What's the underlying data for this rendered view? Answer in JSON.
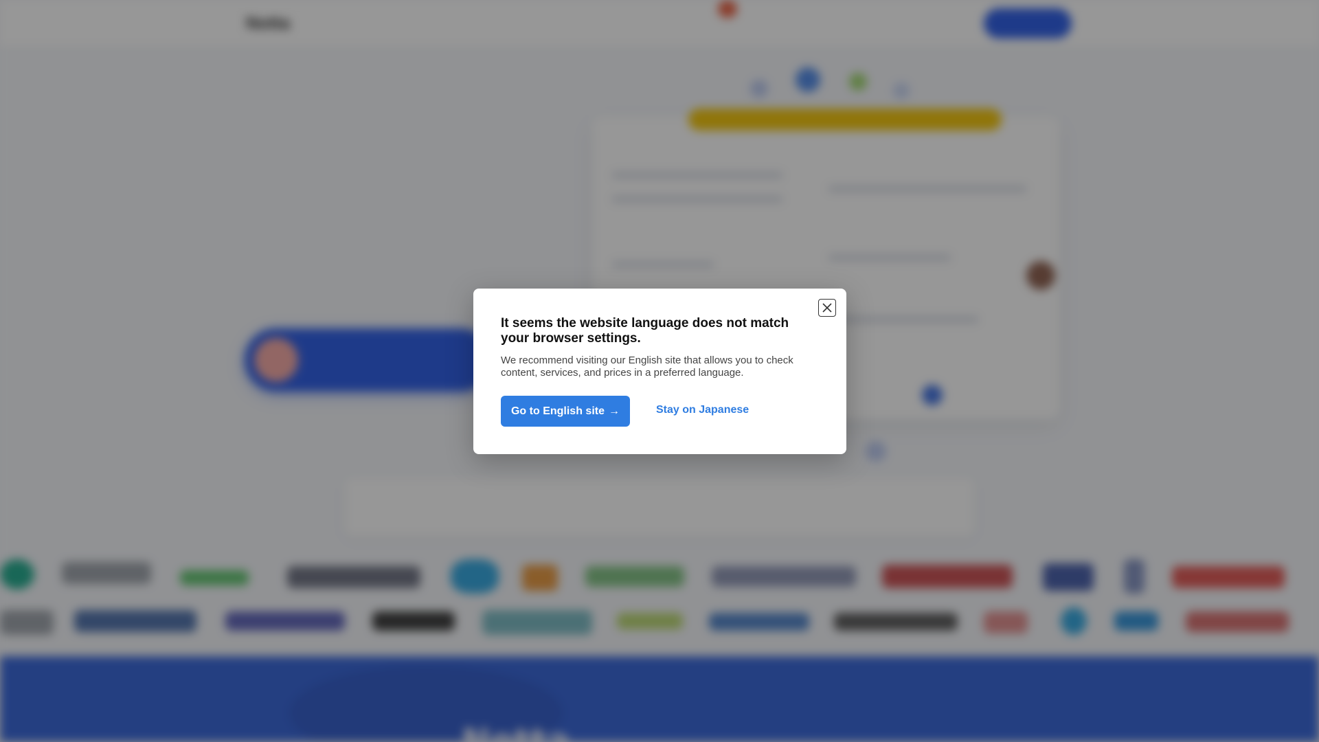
{
  "background_page": {
    "nav": {
      "logo": "Notta",
      "items": [
        "",
        "",
        "",
        "",
        "",
        ""
      ],
      "lang": "",
      "login": "",
      "cta": ""
    },
    "hero": {
      "title_line1": "",
      "title_line2": "",
      "description": "",
      "note": "",
      "cta_label": "",
      "sub_link": ""
    },
    "stats": {
      "text": ""
    },
    "section_title": "Notta"
  },
  "modal": {
    "title": "It seems the website language does not match your browser settings.",
    "body": "We recommend visiting our English site that allows you to check content, services, and prices in a preferred language.",
    "primary_button": "Go to English site",
    "primary_arrow": "→",
    "secondary_button": "Stay on Japanese",
    "close_icon": "close-icon"
  },
  "colors": {
    "accent": "#2f7de1",
    "brand_blue": "#2457e6",
    "overlay": "rgba(25,25,25,0.45)"
  }
}
